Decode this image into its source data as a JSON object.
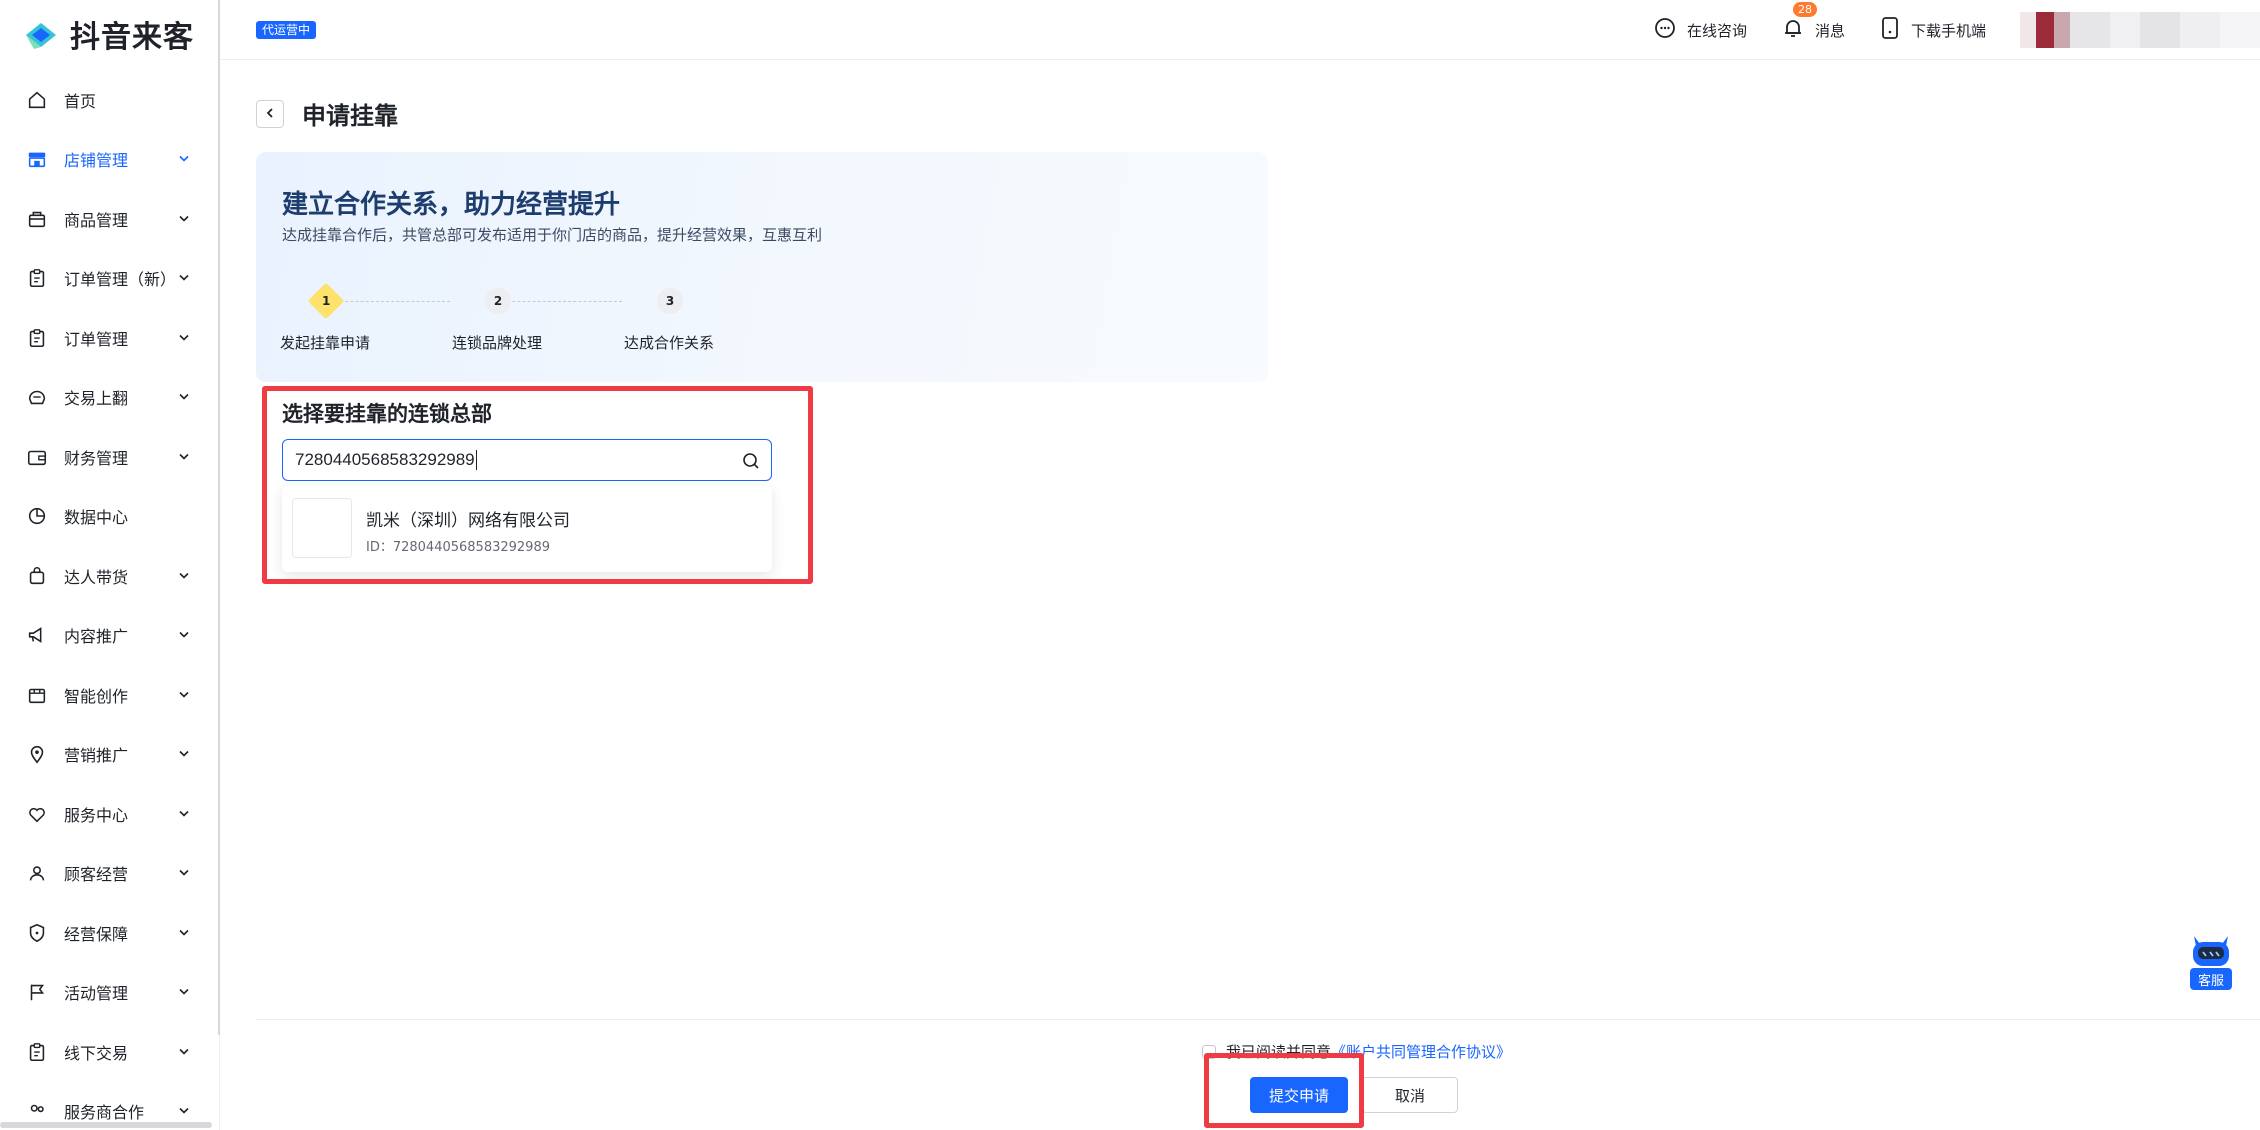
{
  "app": {
    "logo_text": "抖音来客",
    "mode_badge": "代运营中"
  },
  "topbar": {
    "consult_label": "在线咨询",
    "messages_label": "消息",
    "messages_count": "28",
    "download_label": "下载手机端"
  },
  "sidebar": {
    "items": [
      {
        "label": "首页",
        "icon": "home-icon",
        "active": false,
        "expandable": false
      },
      {
        "label": "店铺管理",
        "icon": "store-icon",
        "active": true,
        "expandable": true
      },
      {
        "label": "商品管理",
        "icon": "basket-icon",
        "active": false,
        "expandable": true
      },
      {
        "label": "订单管理（新）",
        "icon": "clipboard-icon",
        "active": false,
        "expandable": true
      },
      {
        "label": "订单管理",
        "icon": "clipboard-icon",
        "active": false,
        "expandable": true
      },
      {
        "label": "交易上翻",
        "icon": "trade-icon",
        "active": false,
        "expandable": true
      },
      {
        "label": "财务管理",
        "icon": "wallet-icon",
        "active": false,
        "expandable": true
      },
      {
        "label": "数据中心",
        "icon": "pie-chart-icon",
        "active": false,
        "expandable": false
      },
      {
        "label": "达人带货",
        "icon": "bag-icon",
        "active": false,
        "expandable": true
      },
      {
        "label": "内容推广",
        "icon": "megaphone-icon",
        "active": false,
        "expandable": true
      },
      {
        "label": "智能创作",
        "icon": "create-icon",
        "active": false,
        "expandable": true
      },
      {
        "label": "营销推广",
        "icon": "location-icon",
        "active": false,
        "expandable": true
      },
      {
        "label": "服务中心",
        "icon": "heart-icon",
        "active": false,
        "expandable": true
      },
      {
        "label": "顾客经营",
        "icon": "user-icon",
        "active": false,
        "expandable": true
      },
      {
        "label": "经营保障",
        "icon": "shield-icon",
        "active": false,
        "expandable": true
      },
      {
        "label": "活动管理",
        "icon": "flag-icon",
        "active": false,
        "expandable": true
      },
      {
        "label": "线下交易",
        "icon": "clipboard-icon",
        "active": false,
        "expandable": true
      },
      {
        "label": "服务商合作",
        "icon": "partner-icon",
        "active": false,
        "expandable": true
      }
    ]
  },
  "page": {
    "title": "申请挂靠",
    "hero_title": "建立合作关系，助力经营提升",
    "hero_subtitle": "达成挂靠合作后，共管总部可发布适用于你门店的商品，提升经营效果，互惠互利",
    "steps": [
      {
        "num": "1",
        "label": "发起挂靠申请",
        "state": "active"
      },
      {
        "num": "2",
        "label": "连锁品牌处理",
        "state": "todo"
      },
      {
        "num": "3",
        "label": "达成合作关系",
        "state": "todo"
      }
    ],
    "section_title": "选择要挂靠的连锁总部",
    "search_value": "7280440568583292989",
    "result": {
      "name": "凯米（深圳）网络有限公司",
      "id_text": "ID：7280440568583292989"
    }
  },
  "footer": {
    "agree_text": "我已阅读并同意",
    "agree_link": "《账户共同管理合作协议》",
    "submit_label": "提交申请",
    "cancel_label": "取消"
  },
  "service": {
    "label": "客服"
  },
  "colors": {
    "primary": "#1966ff",
    "highlight": "#ef3b44",
    "step_active": "#ffe26b",
    "badge_orange": "#ff7a2e"
  }
}
